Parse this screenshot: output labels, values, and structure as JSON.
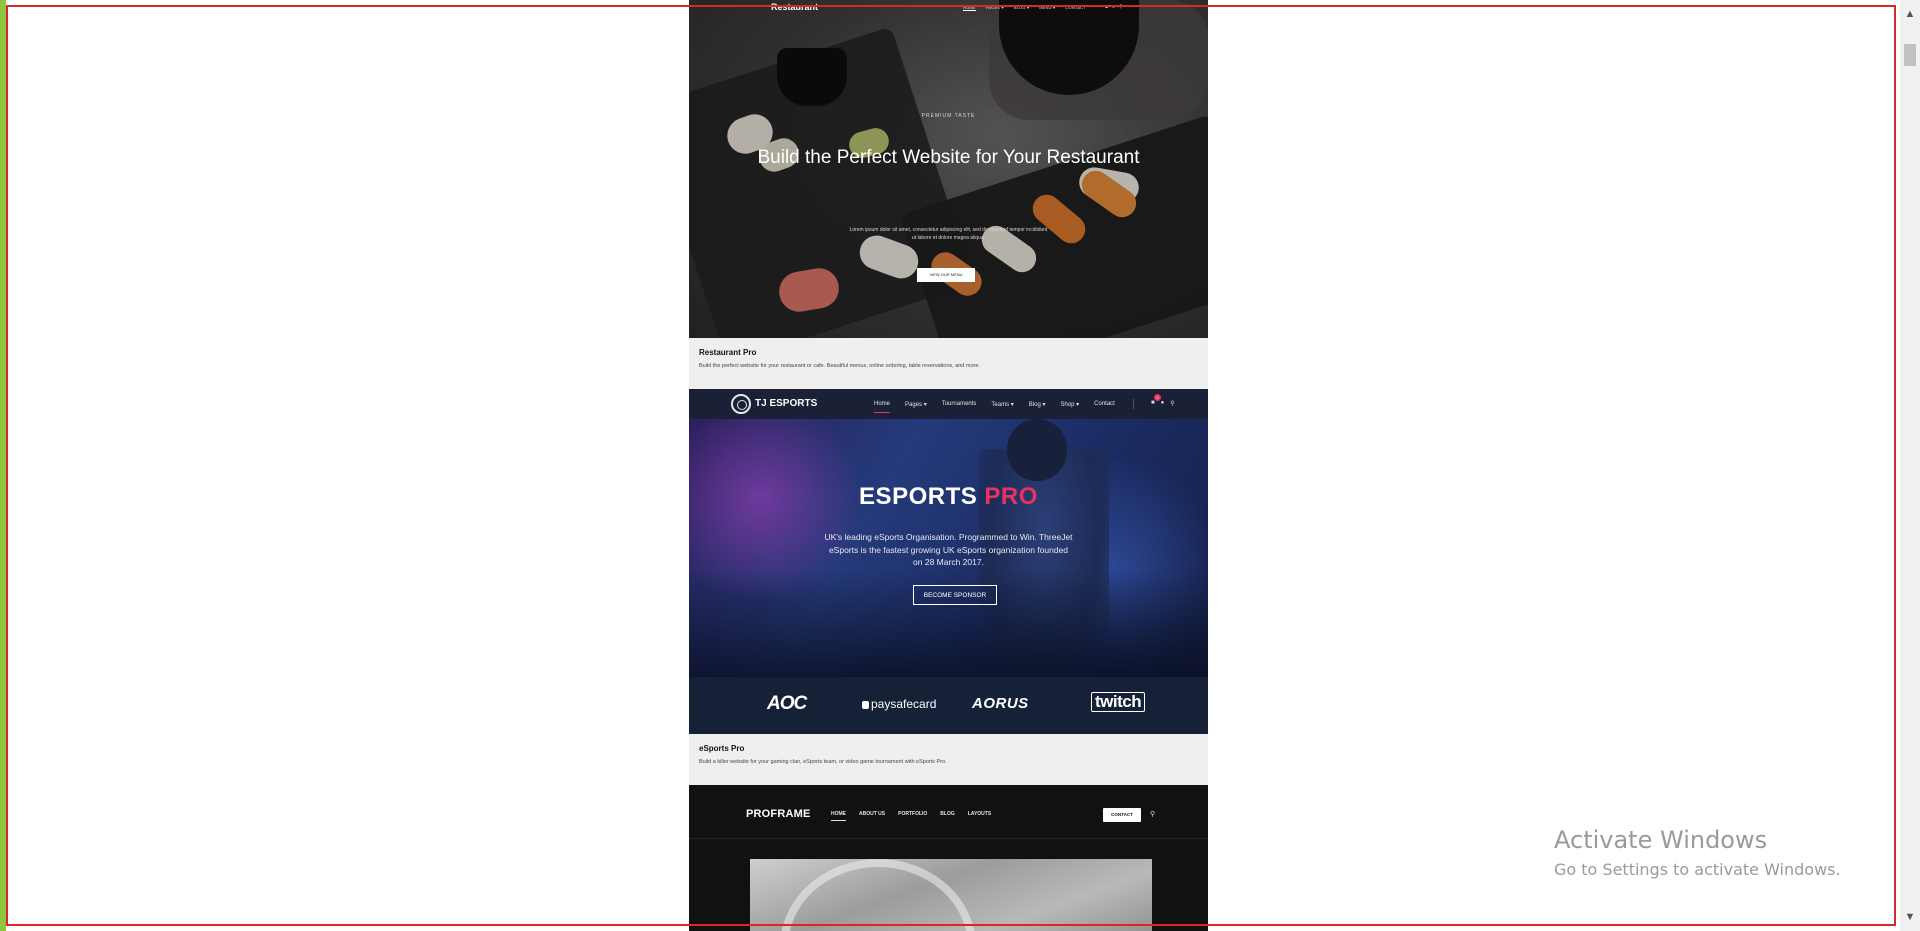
{
  "restaurant": {
    "logo": "Restaurant",
    "nav": [
      "HOME",
      "PAGES ▾",
      "BLOG ▾",
      "MENU ▾",
      "CONTACT"
    ],
    "eyebrow": "PREMIUM TASTE",
    "title": "Build the Perfect Website for Your Restaurant",
    "description": "Lorem ipsum dolor sit amet, consectetur adipiscing elit, sed do eiusmod tempor incididunt ut labore et dolore magna aliqua.",
    "button": "VIEW OUR MENU",
    "card_title": "Restaurant Pro",
    "card_description": "Build the perfect website for your restaurant or cafe. Beautiful menus, online ordering, table reservations, and more."
  },
  "esports": {
    "logo": "TJ ESPORTS",
    "nav": [
      "Home",
      "Pages ▾",
      "Tournaments",
      "Teams ▾",
      "Blog ▾",
      "Shop ▾",
      "Contact"
    ],
    "cart_count": "0",
    "title_main": "ESPORTS",
    "title_accent": "PRO",
    "description": "UK's leading eSports Organisation. Programmed to Win. ThreeJet eSports is the fastest growing UK eSports organization founded on 28 March 2017.",
    "button": "BECOME SPONSOR",
    "sponsors": [
      "AOC",
      "paysafecard",
      "AORUS",
      "twitch"
    ],
    "card_title": "eSports Pro",
    "card_description": "Build a killer website for your gaming clan, eSports team, or video game tournament with eSports Pro."
  },
  "proframe": {
    "logo": "PROFRAME",
    "nav": [
      "HOME",
      "ABOUT US",
      "PORTFOLIO",
      "BLOG",
      "LAYOUTS"
    ],
    "contact": "CONTACT"
  },
  "watermark": {
    "title": "Activate Windows",
    "subtitle": "Go to Settings to activate Windows."
  },
  "colors": {
    "frame_red": "#d9262c",
    "left_strip": "#8cc63f",
    "esports_accent": "#e6335f"
  },
  "icons": [
    "cart-icon",
    "user-icon",
    "search-icon",
    "chevron-up-icon",
    "chevron-down-icon"
  ]
}
